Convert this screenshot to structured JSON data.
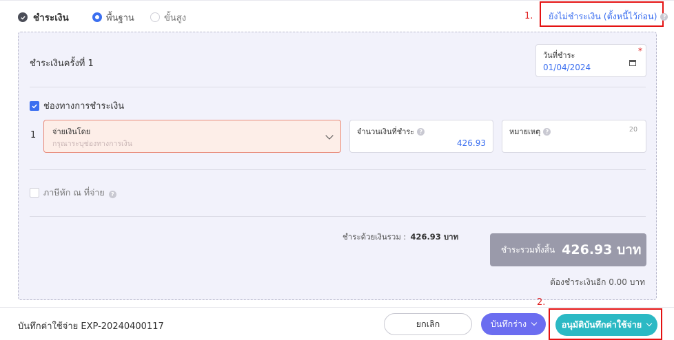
{
  "header": {
    "title": "ชำระเงิน",
    "radio_basic": "พื้นฐาน",
    "radio_advanced": "ขั้นสูง",
    "unpaid_link": "ยังไม่ชำระเงิน (ตั้งหนี้ไว้ก่อน)"
  },
  "annotations": {
    "one": "1.",
    "two": "2."
  },
  "installment": {
    "title": "ชำระเงินครั้งที่ 1",
    "date_label": "วันที่ชำระ",
    "date_value": "01/04/2024",
    "required_mark": "*"
  },
  "channel": {
    "label": "ช่องทางการชำระเงิน",
    "row_index": "1",
    "pay_by_label": "จ่ายเงินโดย",
    "pay_by_placeholder": "กรุณาระบุช่องทางการเงิน",
    "amount_label": "จำนวนเงินที่ชำระ",
    "amount_value": "426.93",
    "note_label": "หมายเหตุ",
    "note_counter": "20"
  },
  "withholding": {
    "label": "ภาษีหัก ณ ที่จ่าย"
  },
  "summary": {
    "paid_total_label": "ชำระด้วยเงินรวม :",
    "paid_total_value": "426.93 บาท",
    "grand_total_label": "ชำระรวมทั้งสิ้น",
    "grand_total_value": "426.93 บาท",
    "remaining": "ต้องชำระเงินอีก 0.00 บาท"
  },
  "footer": {
    "doc_title": "บันทึกค่าใช้จ่าย EXP-20240400117",
    "cancel": "ยกเลิก",
    "save_draft": "บันทึกร่าง",
    "approve": "อนุมัติบันทึกค่าใช้จ่าย"
  },
  "colors": {
    "accent": "#3b6ff0",
    "approve": "#2bb9c4",
    "draft": "#6b6df0",
    "highlight": "#e41212",
    "panel_bg": "#f2f2fb"
  }
}
